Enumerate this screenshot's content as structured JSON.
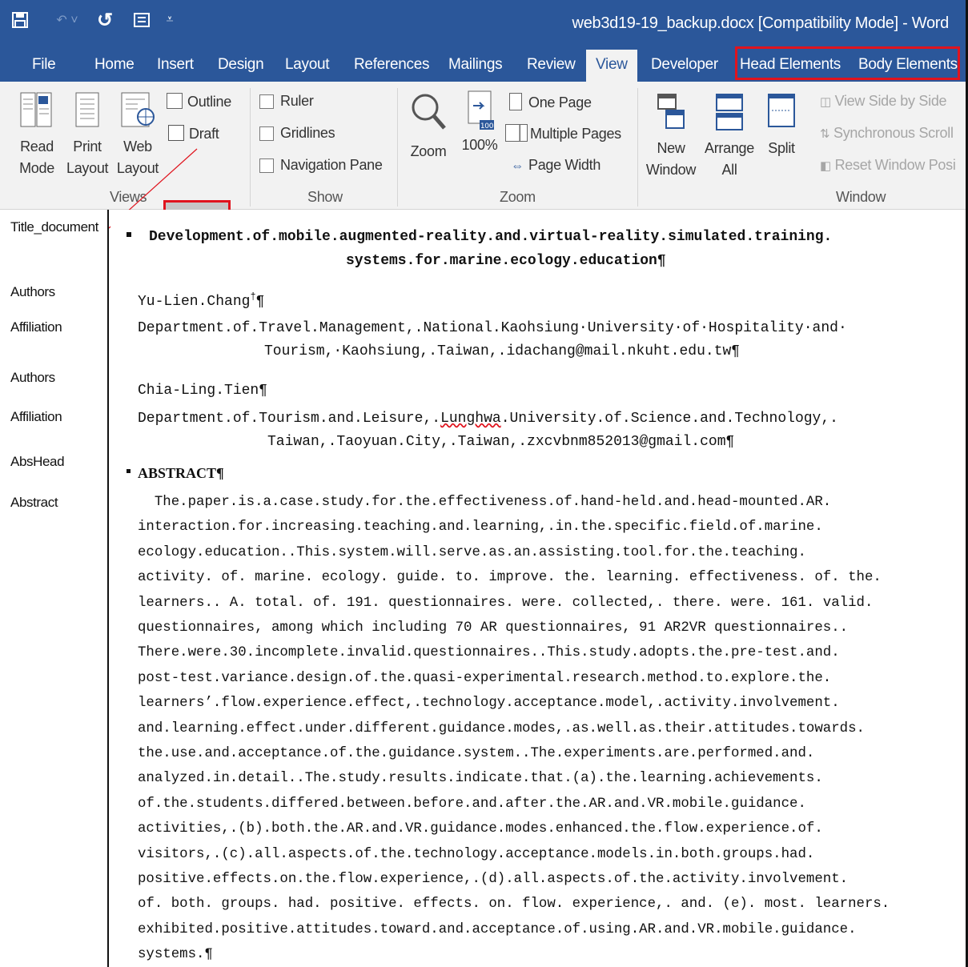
{
  "titlebar": {
    "doc_title": "web3d19-19_backup.docx [Compatibility Mode] - Word"
  },
  "tabs": [
    {
      "label": "File"
    },
    {
      "label": "Home"
    },
    {
      "label": "Insert"
    },
    {
      "label": "Design"
    },
    {
      "label": "Layout"
    },
    {
      "label": "References"
    },
    {
      "label": "Mailings"
    },
    {
      "label": "Review"
    },
    {
      "label": "View"
    },
    {
      "label": "Developer"
    },
    {
      "label": "Head Elements"
    },
    {
      "label": "Body Elements"
    }
  ],
  "ribbon": {
    "views": {
      "read_mode": "Read\nMode",
      "print_layout": "Print\nLayout",
      "web_layout": "Web\nLayout",
      "outline": "Outline",
      "draft": "Draft",
      "label": "Views"
    },
    "show": {
      "ruler": "Ruler",
      "gridlines": "Gridlines",
      "navigation_pane": "Navigation Pane",
      "label": "Show"
    },
    "zoom": {
      "zoom": "Zoom",
      "hundred": "100%",
      "one_page": "One Page",
      "multiple_pages": "Multiple Pages",
      "page_width": "Page Width",
      "label": "Zoom"
    },
    "window": {
      "new_window": "New\nWindow",
      "arrange_all": "Arrange\nAll",
      "split": "Split",
      "side_by_side": "View Side by Side",
      "sync_scroll": "Synchronous Scroll",
      "reset_window": "Reset Window Posi",
      "label": "Window"
    }
  },
  "styles": [
    "Title_document",
    "Authors",
    "Affiliation",
    "Authors",
    "Affiliation",
    "AbsHead",
    "Abstract"
  ],
  "document": {
    "title_1": "Development.of.mobile.augmented-reality.and.virtual-reality.simulated.training.",
    "title_2": "systems.for.marine.ecology.education¶",
    "author1": "Yu-Lien.Chang",
    "author1_mark": "†",
    "affil1_1": "Department.of.Travel.Management,.National.Kaohsiung·University·of·Hospitality·and·",
    "affil1_2": "Tourism,·Kaohsiung,.Taiwan,.idachang@mail.nkuht.edu.tw¶",
    "author2": "Chia-Ling.Tien¶",
    "affil2_1a": "Department.of.Tourism.and.Leisure,.",
    "affil2_1b": "Lunghwa",
    "affil2_1c": ".University.of.Science.and.Technology,.",
    "affil2_2": "Taiwan,.Taoyuan.City,.Taiwan,.zxcvbnm852013@gmail.com¶",
    "abs_head": "ABSTRACT¶",
    "abstract": [
      "  The.paper.is.a.case.study.for.the.effectiveness.of.hand-held.and.head-mounted.AR.",
      "interaction.for.increasing.teaching.and.learning,.in.the.specific.field.of.marine.",
      "ecology.education..This.system.will.serve.as.an.assisting.tool.for.the.teaching.",
      "activity. of. marine. ecology. guide. to. improve. the. learning. effectiveness. of. the.",
      "learners.. A. total. of. 191. questionnaires. were. collected,. there. were. 161. valid.",
      "questionnaires, among which including 70 AR questionnaires, 91 AR2VR questionnaires..",
      "There.were.30.incomplete.invalid.questionnaires..This.study.adopts.the.pre-test.and.",
      "post-test.variance.design.of.the.quasi-experimental.research.method.to.explore.the.",
      "learners’.flow.experience.effect,.technology.acceptance.model,.activity.involvement.",
      "and.learning.effect.under.different.guidance.modes,.as.well.as.their.attitudes.towards.",
      "the.use.and.acceptance.of.the.guidance.system..The.experiments.are.performed.and.",
      "analyzed.in.detail..The.study.results.indicate.that.(a).the.learning.achievements.",
      "of.the.students.differed.between.before.and.after.the.AR.and.VR.mobile.guidance.",
      "activities,.(b).both.the.AR.and.VR.guidance.modes.enhanced.the.flow.experience.of.",
      "visitors,.(c).all.aspects.of.the.technology.acceptance.models.in.both.groups.had.",
      "positive.effects.on.the.flow.experience,.(d).all.aspects.of.the.activity.involvement.",
      "of. both. groups. had. positive. effects. on. flow. experience,. and. (e). most. learners.",
      "exhibited.positive.attitudes.toward.and.acceptance.of.using.AR.and.VR.mobile.guidance.",
      "systems.¶"
    ]
  },
  "colors": {
    "word_blue": "#2b579a",
    "ribbon_bg": "#f2f2f2",
    "highlight_red": "#e0141e"
  }
}
